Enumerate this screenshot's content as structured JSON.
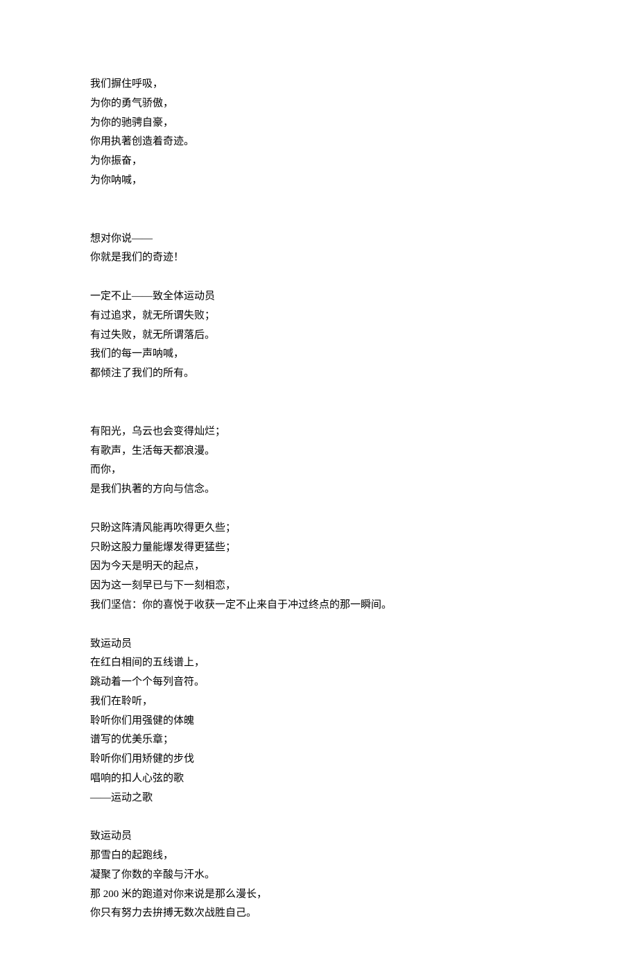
{
  "stanzas": [
    {
      "lines": [
        "我们摒住呼吸，",
        "为你的勇气骄傲，",
        "为你的驰骋自豪，",
        "你用执著创造着奇迹。",
        "为你振奋，",
        "为你呐喊，"
      ]
    },
    {
      "lines": [
        "想对你说——",
        "你就是我们的奇迹！"
      ]
    },
    {
      "lines": [
        "一定不止——致全体运动员",
        "有过追求，就无所谓失败；",
        "有过失败，就无所谓落后。",
        "我们的每一声呐喊，",
        "都倾注了我们的所有。"
      ]
    },
    {
      "lines": [
        "有阳光，乌云也会变得灿烂；",
        "有歌声，生活每天都浪漫。",
        "而你，",
        "是我们执著的方向与信念。"
      ]
    },
    {
      "lines": [
        "只盼这阵清风能再吹得更久些；",
        "只盼这股力量能爆发得更猛些；",
        "因为今天是明天的起点，",
        "因为这一刻早已与下一刻相恋，",
        "我们坚信：你的喜悦于收获一定不止来自于冲过终点的那一瞬间。"
      ]
    },
    {
      "lines": [
        "致运动员",
        "在红白相间的五线谱上，",
        "跳动着一个个每列音符。",
        "我们在聆听，",
        "聆听你们用强健的体魄",
        "谱写的优美乐章；",
        "聆听你们用矫健的步伐",
        "唱响的扣人心弦的歌",
        "——运动之歌"
      ]
    },
    {
      "lines": [
        "致运动员",
        "那雪白的起跑线，",
        "凝聚了你数的辛酸与汗水。",
        "那 200 米的跑道对你来说是那么漫长，",
        "你只有努力去拚搏无数次战胜自己。"
      ]
    }
  ]
}
